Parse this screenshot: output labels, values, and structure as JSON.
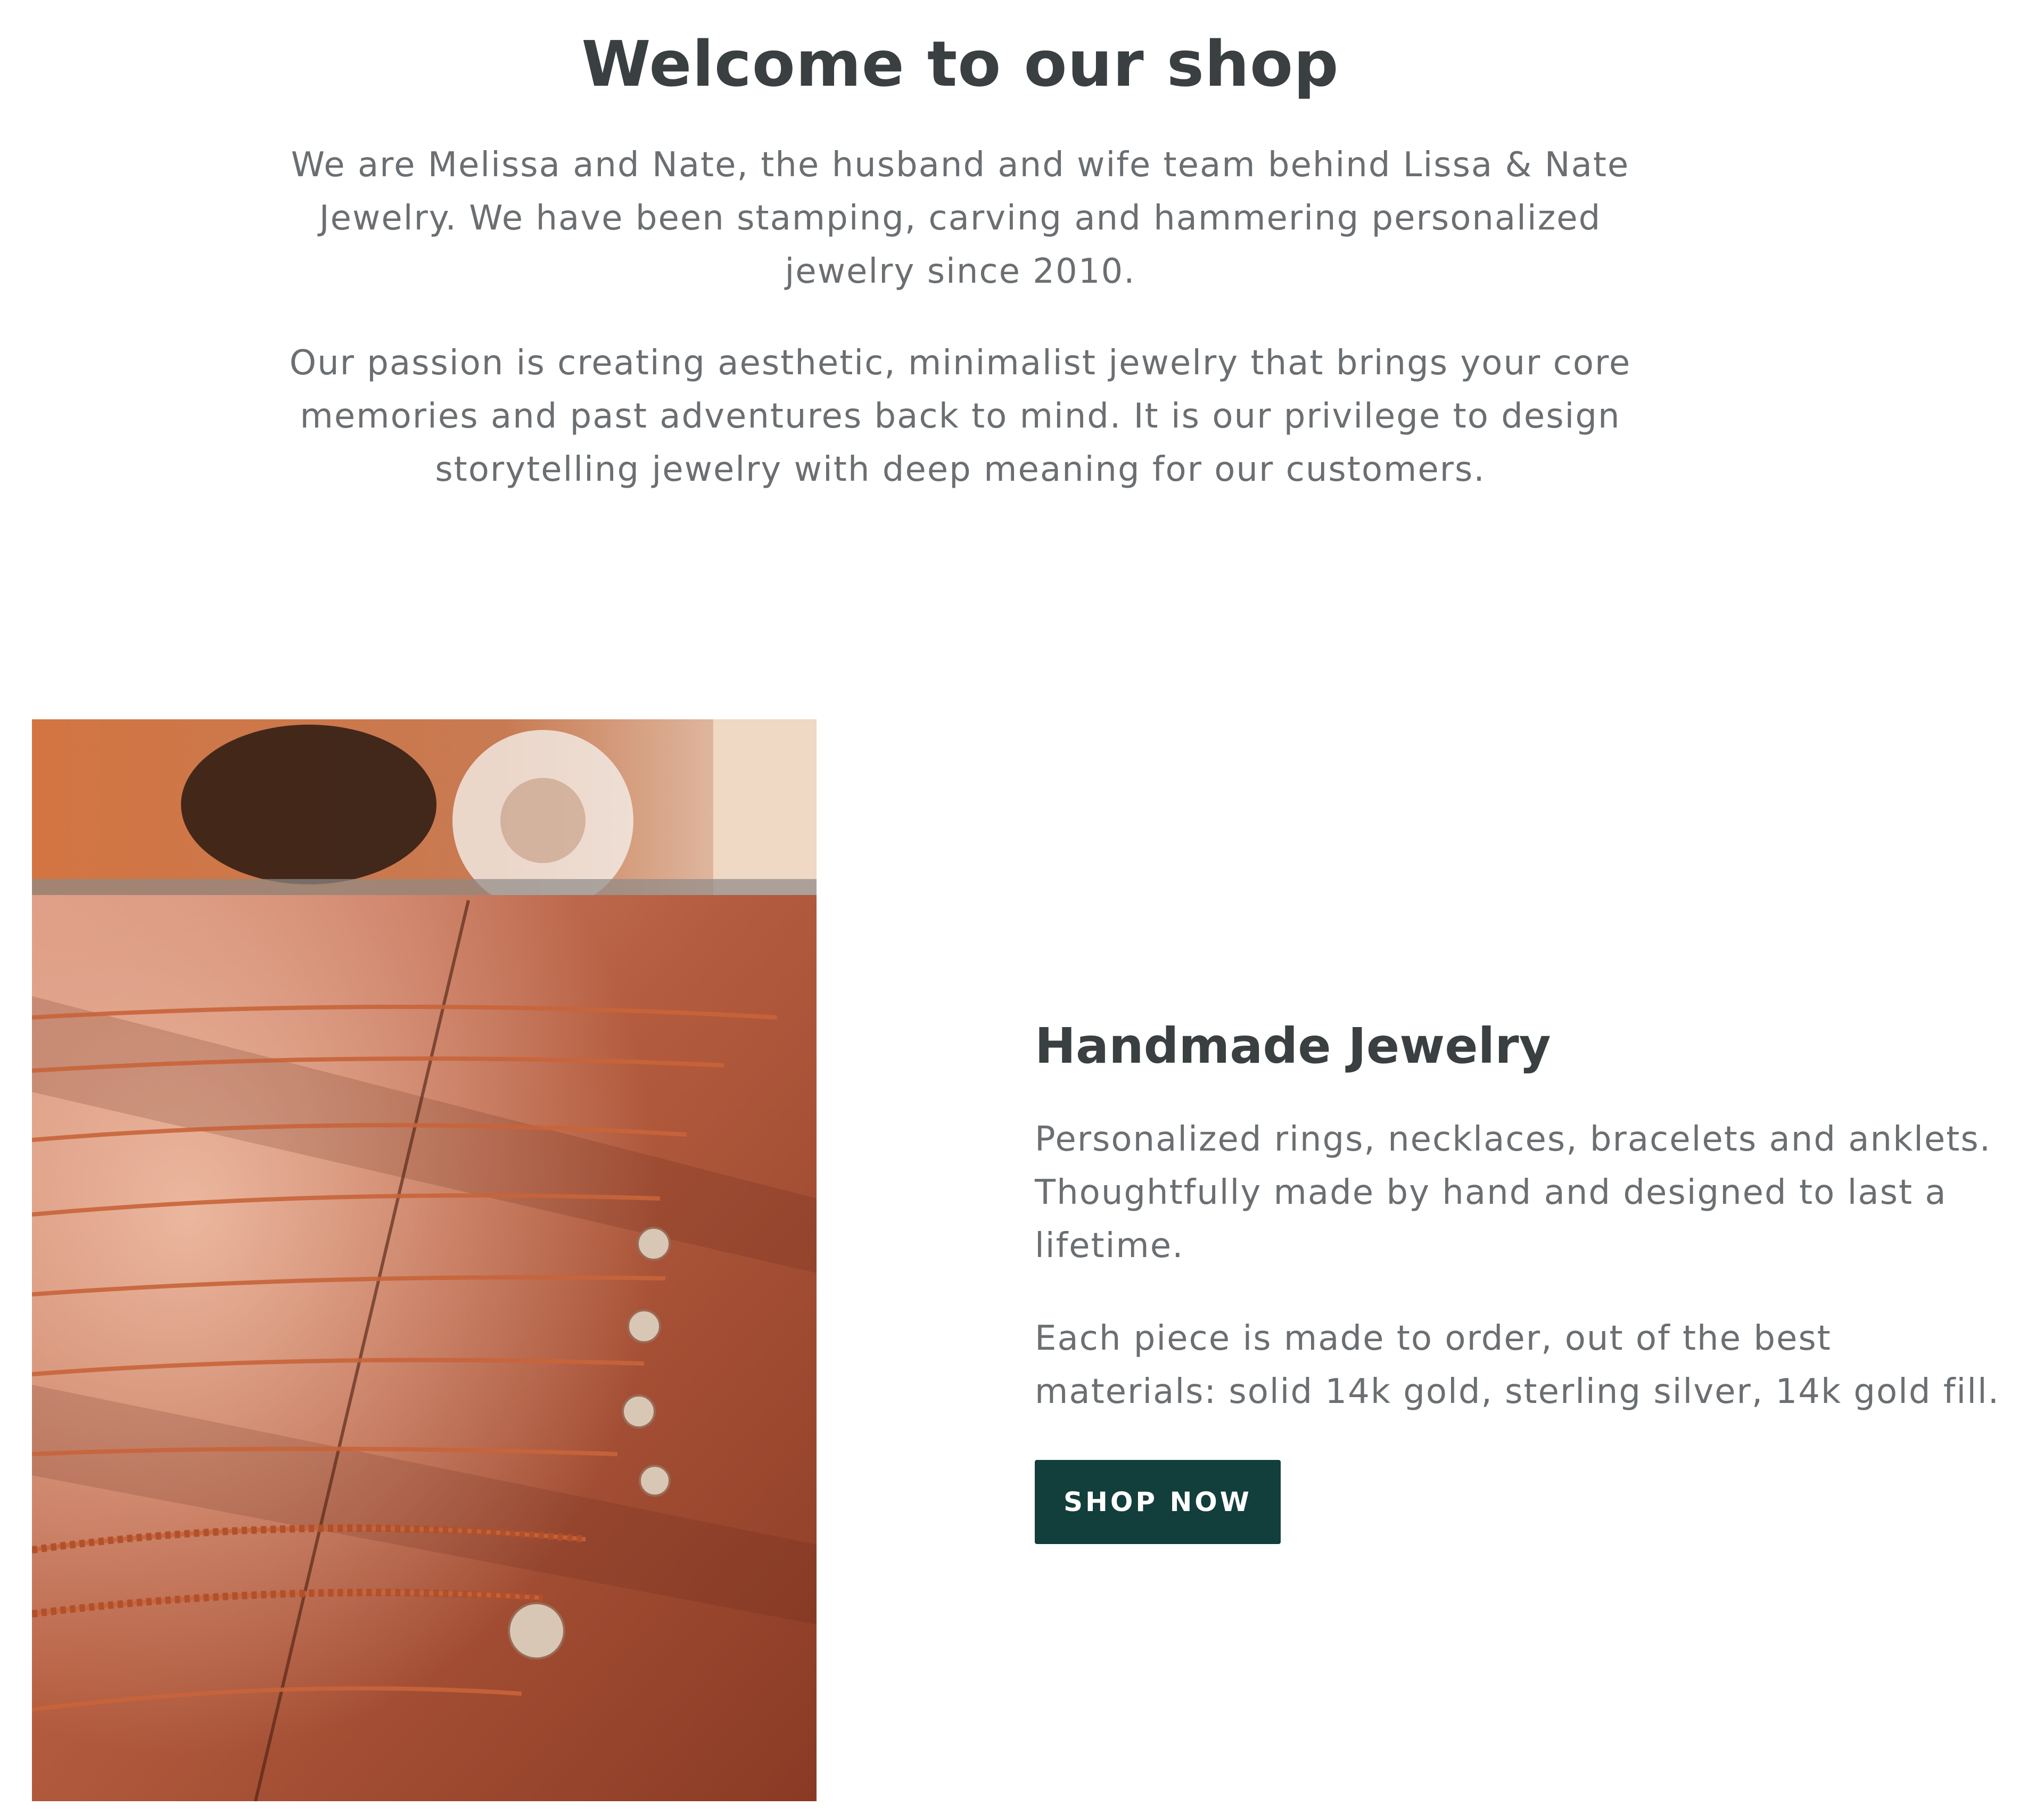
{
  "intro": {
    "title": "Welcome to our shop",
    "paragraph_1": "We are Melissa and Nate, the husband and wife team behind Lissa & Nate Jewelry. We have been stamping, carving and hammering personalized jewelry since 2010.",
    "paragraph_2": "Our passion is creating aesthetic, minimalist jewelry that brings your core memories and past adventures back to mind. It is our privilege to design storytelling jewelry with deep meaning for our customers."
  },
  "feature": {
    "image_subject": "handmade necklaces laid on a wooden table",
    "heading": "Handmade Jewelry",
    "paragraph_1": "Personalized rings, necklaces, bracelets and anklets. Thoughtfully made by hand and designed to last a lifetime.",
    "paragraph_2": "Each piece is made to order, out of the best materials: solid 14k gold, sterling silver, 14k gold fill.",
    "button_label": "SHOP NOW"
  },
  "colors": {
    "heading": "#3a3f41",
    "body_text": "#6b6f72",
    "button_bg": "#123e3c",
    "button_text": "#ffffff",
    "background": "#ffffff"
  }
}
